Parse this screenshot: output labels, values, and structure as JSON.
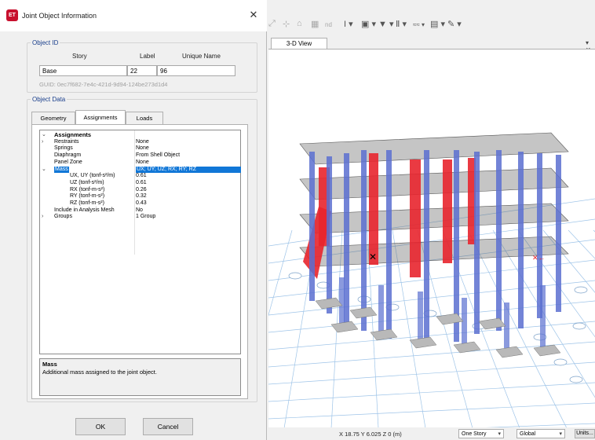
{
  "dialog": {
    "title": "Joint Object Information",
    "app_badge": "ET",
    "close_glyph": "✕",
    "object_id": {
      "legend": "Object ID",
      "story_label": "Story",
      "label_label": "Label",
      "unique_name_label": "Unique Name",
      "story": "Base",
      "label": "22",
      "unique_name": "96",
      "guid": "GUID:  0ec7f682-7e4c-421d-9d94-124be273d1d4"
    },
    "object_data": {
      "legend": "Object Data",
      "tabs": [
        {
          "label": "Geometry",
          "active": false
        },
        {
          "label": "Assignments",
          "active": true
        },
        {
          "label": "Loads",
          "active": false
        }
      ]
    },
    "grid": {
      "rows": [
        {
          "exp": "⌄",
          "name": "Assignments",
          "value": "",
          "kind": "head"
        },
        {
          "exp": "›",
          "name": "Restraints",
          "value": "None",
          "kind": "normal"
        },
        {
          "exp": "",
          "name": "Springs",
          "value": "None",
          "kind": "normal"
        },
        {
          "exp": "",
          "name": "Diaphragm",
          "value": "From Shell Object",
          "kind": "normal"
        },
        {
          "exp": "",
          "name": "Panel Zone",
          "value": "None",
          "kind": "normal"
        },
        {
          "exp": "⌄",
          "name": "Mass",
          "value": "UX; UY; UZ; RX; RY; RZ",
          "kind": "selected"
        },
        {
          "exp": "",
          "name": "UX, UY (tonf-s²/m)",
          "value": "0.61",
          "kind": "sub"
        },
        {
          "exp": "",
          "name": "UZ (tonf-s²/m)",
          "value": "0.61",
          "kind": "sub"
        },
        {
          "exp": "",
          "name": "RX (tonf-m-s²)",
          "value": "0.26",
          "kind": "sub"
        },
        {
          "exp": "",
          "name": "RY (tonf-m-s²)",
          "value": "0.32",
          "kind": "sub"
        },
        {
          "exp": "",
          "name": "RZ (tonf-m-s²)",
          "value": "0.43",
          "kind": "sub"
        },
        {
          "exp": "",
          "name": "Include in Analysis Mesh",
          "value": "No",
          "kind": "normal"
        },
        {
          "exp": "›",
          "name": "Groups",
          "value": "1 Group",
          "kind": "normal"
        }
      ]
    },
    "description": {
      "title": "Mass",
      "text": "Additional mass assigned to the joint object."
    },
    "buttons": {
      "ok": "OK",
      "cancel": "Cancel"
    }
  },
  "app": {
    "toolbar_icons": [
      "select-pointer-icon",
      "snap-icon",
      "reshape-icon",
      "grid-icon",
      "nd-icon",
      "text-tool-icon",
      "display-icon",
      "filter-icon",
      "section-icon",
      "units-icon",
      "layer-icon",
      "draw-icon"
    ],
    "toolbar_nd": "nd",
    "view_tab": "3-D View",
    "pane_arrow": "▾ ✕",
    "status": {
      "coords": "X 18.75  Y 6.025  Z 0 (m)",
      "story_mode": "One Story",
      "coord_system": "Global",
      "units_button": "Units..."
    }
  },
  "colors": {
    "accent_select": "#1177d7",
    "legend_blue": "#1a3f8c",
    "column_blue": "#5a6fd0",
    "wall_red": "#e8252e",
    "grid_line": "#9ec4e8"
  }
}
